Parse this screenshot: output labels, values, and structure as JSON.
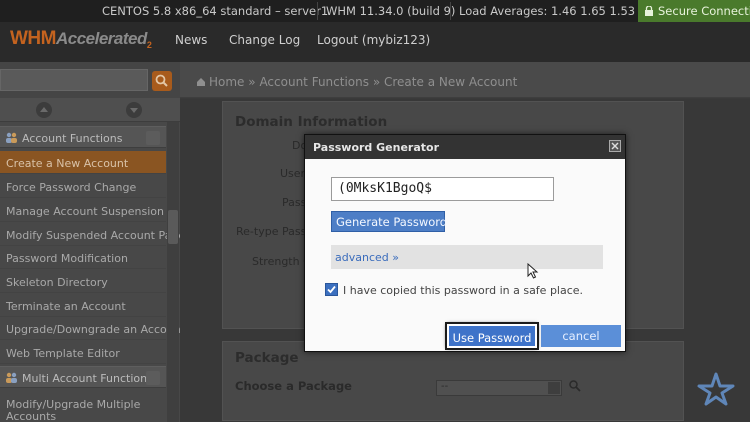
{
  "statusbar": {
    "os": "CENTOS 5.8 x86_64 standard – server1",
    "version": "WHM 11.34.0 (build 9)",
    "load": "Load Averages: 1.46 1.65 1.53",
    "secure": "Secure Connection"
  },
  "header": {
    "logo_main": "WHM",
    "logo_accent": "Accelerated",
    "logo_sub": "2",
    "nav": [
      "News",
      "Change Log",
      "Logout (mybiz123)"
    ]
  },
  "breadcrumb": {
    "home": "Home",
    "sep": "»",
    "section": "Account Functions",
    "current": "Create a New Account"
  },
  "sidebar": {
    "group1": "Account Functions",
    "items": [
      "Create a New Account",
      "Force Password Change",
      "Manage Account Suspension",
      "Modify Suspended Account Page",
      "Password Modification",
      "Skeleton Directory",
      "Terminate an Account",
      "Upgrade/Downgrade an Account",
      "Web Template Editor"
    ],
    "group2": "Multi Account Functions",
    "items2": [
      "Modify/Upgrade Multiple",
      "Accounts"
    ]
  },
  "main": {
    "domain_title": "Domain Information",
    "labels": [
      "Do",
      "User",
      "Pass",
      "Re-type Pass",
      "Strength C"
    ],
    "package_title": "Package",
    "choose_package": "Choose a Package",
    "package_value": "--"
  },
  "modal": {
    "title": "Password Generator",
    "password": "(0MksK1BgoQ$",
    "generate_label": "Generate Password",
    "advanced_label": "advanced »",
    "checkbox_label": "I have copied this password in a safe place.",
    "checkbox_checked": true,
    "use_label": "Use Password",
    "cancel_label": "cancel"
  },
  "colors": {
    "accent": "#c4631f",
    "button_blue": "#3e73c9",
    "secure_green": "#4a7a2c"
  }
}
